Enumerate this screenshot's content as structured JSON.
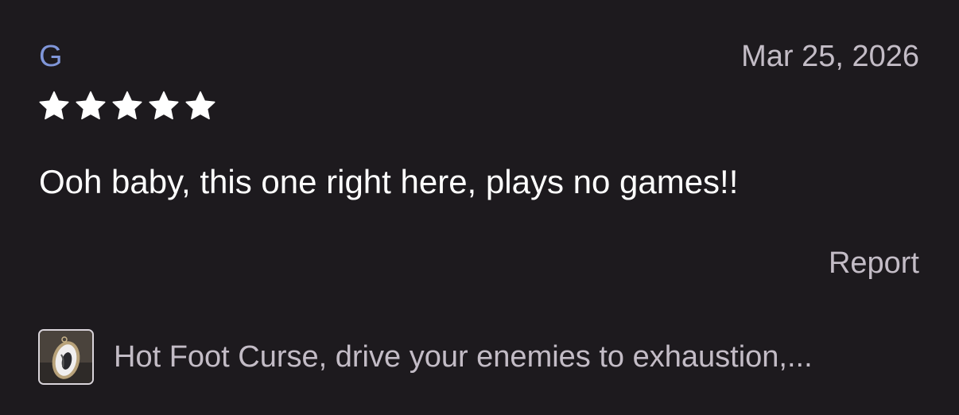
{
  "review": {
    "reviewer": "G",
    "date": "Mar 25, 2026",
    "rating": 5,
    "rating_max": 5,
    "text": "Ooh baby, this one right here, plays no games!!",
    "report_label": "Report"
  },
  "product": {
    "title": "Hot Foot Curse, drive your enemies to exhaustion,...",
    "thumbnail_icon": "pendant-thumbnail"
  },
  "colors": {
    "background": "#1d1a1e",
    "reviewer_accent": "#8096d9",
    "muted_text": "#c3bcc6",
    "primary_text": "#ffffff"
  }
}
